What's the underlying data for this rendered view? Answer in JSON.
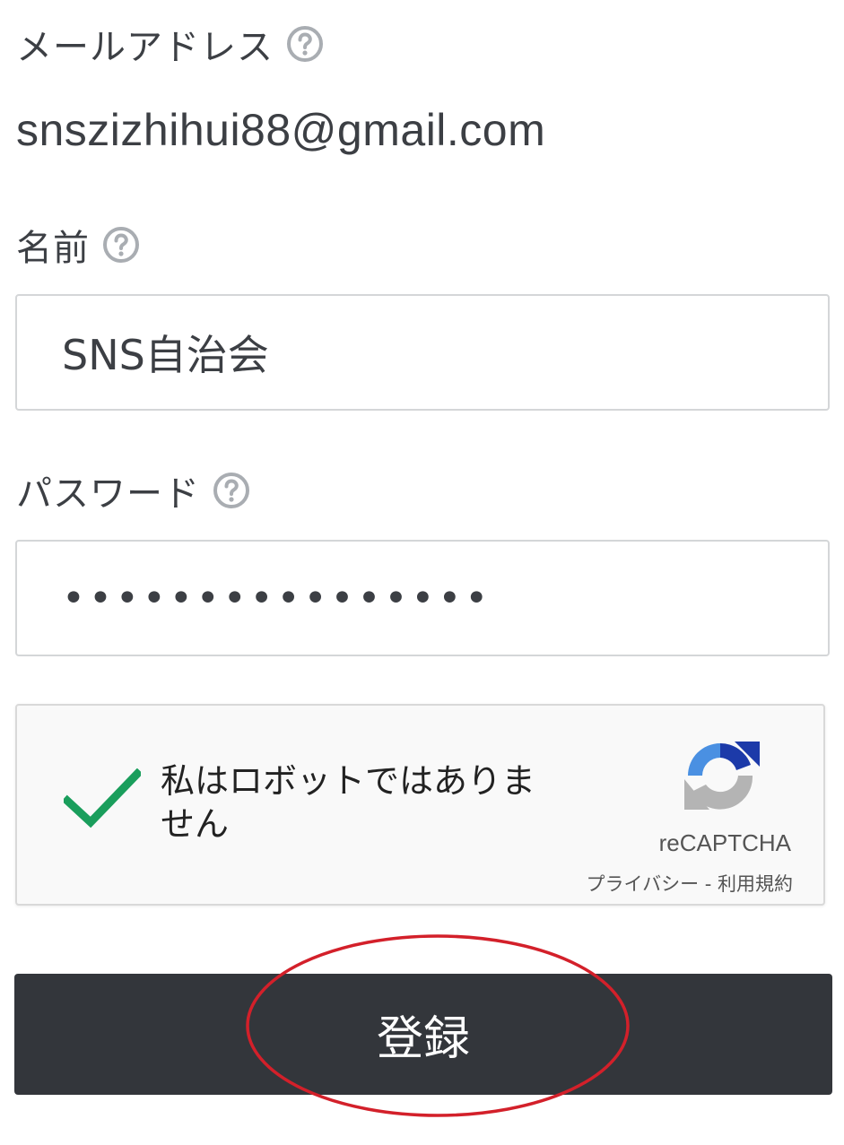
{
  "form": {
    "email": {
      "label": "メールアドレス",
      "value": "snszizhihui88@gmail.com",
      "help_icon": "question-circle-icon"
    },
    "name": {
      "label": "名前",
      "value": "SNS自治会",
      "help_icon": "question-circle-icon"
    },
    "password": {
      "label": "パスワード",
      "masked_value": "••••••••••••••••",
      "help_icon": "question-circle-icon"
    },
    "recaptcha": {
      "text": "私はロボットではありません",
      "checked": true,
      "check_color": "#1a9e5c",
      "brand": "reCAPTCHA",
      "links": "プライバシー - 利用規約",
      "logo_icon": "recaptcha-logo-icon"
    },
    "submit": {
      "label": "登録",
      "background": "#33363b"
    }
  },
  "annotation": {
    "shape": "ellipse",
    "color": "#d3202a"
  }
}
